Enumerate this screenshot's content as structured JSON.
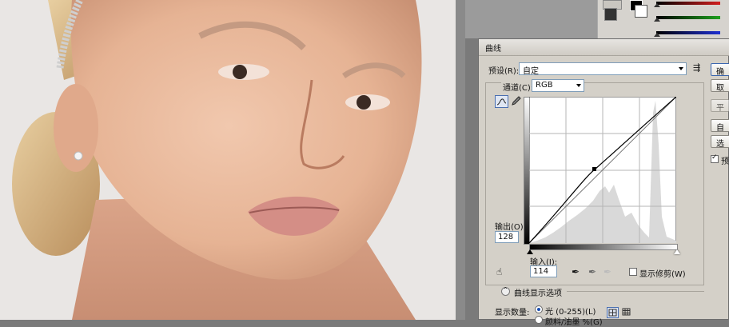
{
  "dialog": {
    "title": "曲线",
    "preset_label": "预设(R):",
    "preset_value": "自定",
    "channel_label": "通道(C):",
    "channel_value": "RGB",
    "output_label": "输出(O):",
    "output_value": "128",
    "input_label": "输入(I):",
    "input_value": "114",
    "show_clipping_label": "显示修剪(W)",
    "curve_display_options_label": "曲线显示选项",
    "show_amount_label": "显示数量:",
    "light_radio_label": "光 (0-255)(L)",
    "pigment_radio_label": "颜料/油墨 %(G)"
  },
  "side_buttons": {
    "ok": "确",
    "cancel": "取",
    "smooth": "平",
    "auto": "自",
    "options": "选",
    "preview": "预"
  },
  "colors": {
    "accent": "#1a4fb3",
    "red_slider": "#d21e1e",
    "green_slider": "#1fa01f",
    "blue_slider": "#1e2fd2"
  },
  "curve": {
    "point_input": 114,
    "point_output": 128
  }
}
